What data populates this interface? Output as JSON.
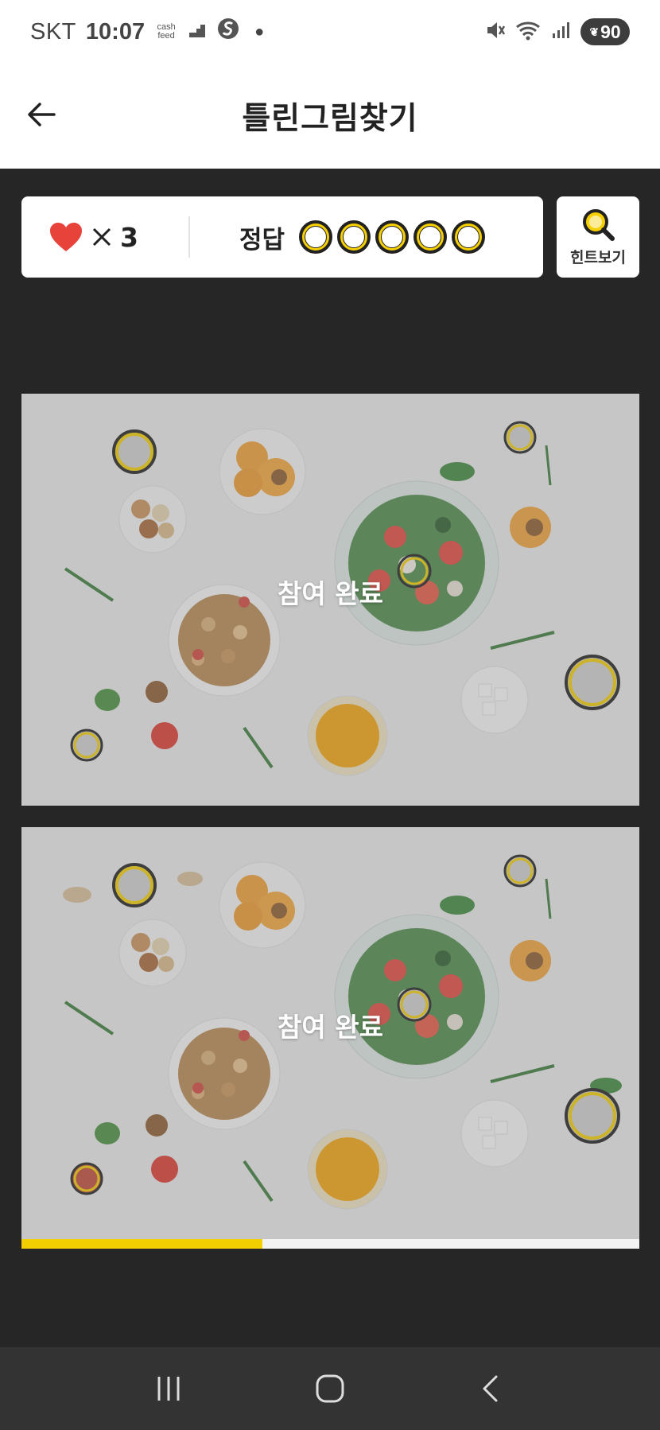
{
  "status_bar": {
    "carrier": "SKT",
    "time": "10:07",
    "cashfeed_label": "cash feed",
    "battery": "90",
    "icons": [
      "mute-icon",
      "wifi-icon",
      "signal-icon"
    ]
  },
  "header": {
    "title": "틀린그림찾기",
    "back_icon": "arrow-left-icon"
  },
  "game": {
    "lives_icon": "heart-icon",
    "lives_multiplier": "×",
    "lives_count": "3",
    "answers_label": "정답",
    "answer_slots": 5,
    "hint_label": "힌트보기",
    "hint_icon": "magnifier-icon",
    "overlay_text": "참여 완료",
    "progress": 0.39
  },
  "colors": {
    "accent": "#f2cf00",
    "heart": "#e8433a",
    "background": "#262626"
  },
  "nav": {
    "buttons": [
      "recent-apps-icon",
      "home-icon",
      "back-icon"
    ]
  }
}
